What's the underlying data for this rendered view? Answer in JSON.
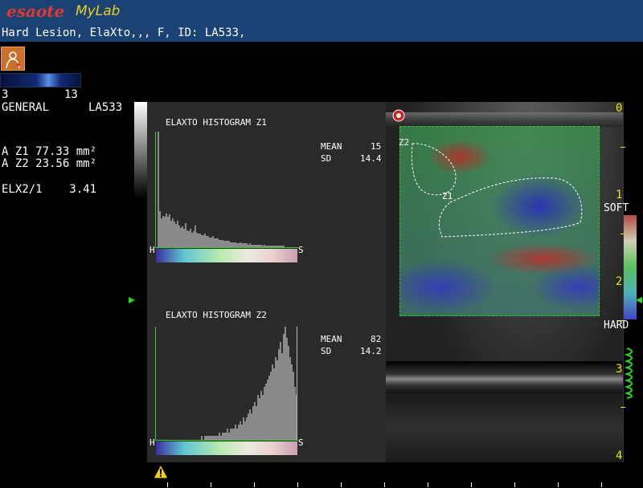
{
  "header": {
    "brand": "esaote",
    "product": "MyLab",
    "patient_line": "Hard Lesion, ElaXto,,, F, ID: LA533,"
  },
  "left_panel": {
    "gray_min": "3",
    "gray_max": "13",
    "preset": "GENERAL",
    "patient_id": "LA533",
    "area_z1": "A Z1 77.33 mm²",
    "area_z2": "A Z2 23.56 mm²",
    "ratio": "ELX2/1    3.41"
  },
  "histogram1": {
    "title": "ELAXTO HISTOGRAM Z1",
    "mean_label": "MEAN",
    "mean_value": "15",
    "sd_label": "SD",
    "sd_value": "14.4",
    "left_label": "H",
    "right_label": "S",
    "bins": [
      0,
      95,
      30,
      24,
      26,
      25,
      28,
      25,
      27,
      22,
      24,
      21,
      19,
      22,
      18,
      16,
      17,
      15,
      20,
      14,
      13,
      15,
      12,
      13,
      18,
      12,
      11,
      11,
      10,
      10,
      11,
      9,
      9,
      8,
      8,
      9,
      7,
      7,
      7,
      6,
      6,
      6,
      5,
      5,
      5,
      5,
      4,
      4,
      4,
      4,
      3,
      3,
      4,
      3,
      3,
      3,
      3,
      2,
      3,
      2,
      2,
      2,
      2,
      2,
      2,
      2,
      1,
      2,
      1,
      1,
      1,
      1,
      1,
      1,
      1,
      1,
      1,
      1,
      1,
      1,
      0,
      0,
      0,
      0,
      0,
      0,
      0,
      0
    ]
  },
  "histogram2": {
    "title": "ELAXTO HISTOGRAM Z2",
    "mean_label": "MEAN",
    "mean_value": "82",
    "sd_label": "SD",
    "sd_value": "14.2",
    "left_label": "H",
    "right_label": "S",
    "bins": [
      0,
      0,
      0,
      0,
      0,
      0,
      0,
      0,
      0,
      0,
      0,
      0,
      0,
      0,
      0,
      0,
      0,
      0,
      0,
      0,
      0,
      0,
      0,
      0,
      0,
      0,
      0,
      0,
      1,
      0,
      1,
      1,
      1,
      1,
      1,
      1,
      1,
      1,
      1,
      2,
      1,
      2,
      2,
      2,
      3,
      2,
      3,
      3,
      3,
      4,
      3,
      4,
      5,
      4,
      6,
      5,
      6,
      7,
      8,
      7,
      9,
      10,
      9,
      12,
      11,
      13,
      12,
      14,
      15,
      16,
      17,
      18,
      20,
      19,
      22,
      21,
      24,
      26,
      23,
      28,
      30,
      27,
      25,
      22,
      20,
      18,
      14,
      12
    ]
  },
  "image": {
    "zone1_label": "Z1",
    "zone2_label": "Z2",
    "scale_soft": "SOFT",
    "scale_hard": "HARD",
    "depth_labels": [
      "0",
      "1",
      "2",
      "3",
      "4"
    ]
  },
  "colors": {
    "header_bg": "#1b4274",
    "roi_border": "#21d021",
    "depth_text": "#e8e800"
  },
  "icons": [
    "probe-body-icon",
    "warning-icon",
    "focus-marker-icon",
    "esaote-badge-icon"
  ]
}
